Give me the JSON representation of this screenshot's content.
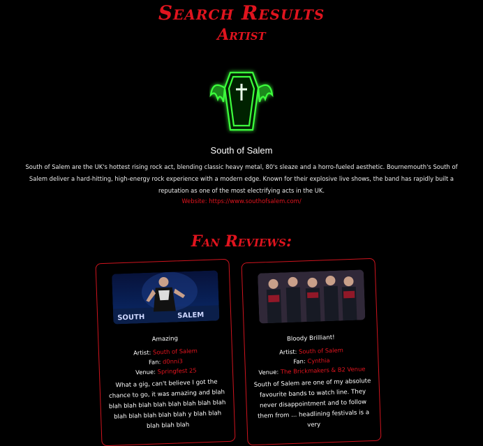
{
  "header": {
    "title": "Search Results",
    "subtitle": "Artist"
  },
  "artist": {
    "name": "South of Salem",
    "bio": "South of Salem are the UK's hottest rising rock act, blending classic heavy metal, 80's sleaze and a horro-fueled aesthetic. Bournemouth's South of Salem deliver a hard-hitting, high-energy rock experience with a modern edge. Known for their explosive live shows, the band has rapidly built a reputation as one of the most electrifying acts in the UK.",
    "website_label": "Website:",
    "website_url": "https://www.southofsalem.com/",
    "logo_icon": "coffin-bat-logo-icon"
  },
  "reviews": {
    "heading": "Fan Reviews:",
    "items": [
      {
        "title": "Amazing",
        "artist_label": "Artist:",
        "artist": "South of Salem",
        "fan_label": "Fan:",
        "fan": "d0nni3",
        "venue_label": "Venue:",
        "venue": "Springfest 25",
        "body": "What a gig, can't believe I got the chance to go, it was amazing and blah blah blah blah blah blah blah blah blah blah blah blah blah blah y blah blah blah blah blah"
      },
      {
        "title": "Bloody Brilliant!",
        "artist_label": "Artist:",
        "artist": "South of Salem",
        "fan_label": "Fan:",
        "fan": "Cynthia",
        "venue_label": "Venue:",
        "venue": "The Brickmakers & B2 Venue",
        "body": "South of Salem are one of my absolute favourite bands to watch line. They never disappointment and to follow them from ... headlining festivals is a very"
      }
    ]
  },
  "colors": {
    "accent": "#e0141e",
    "glow": "#3cff3c",
    "background": "#000000"
  }
}
